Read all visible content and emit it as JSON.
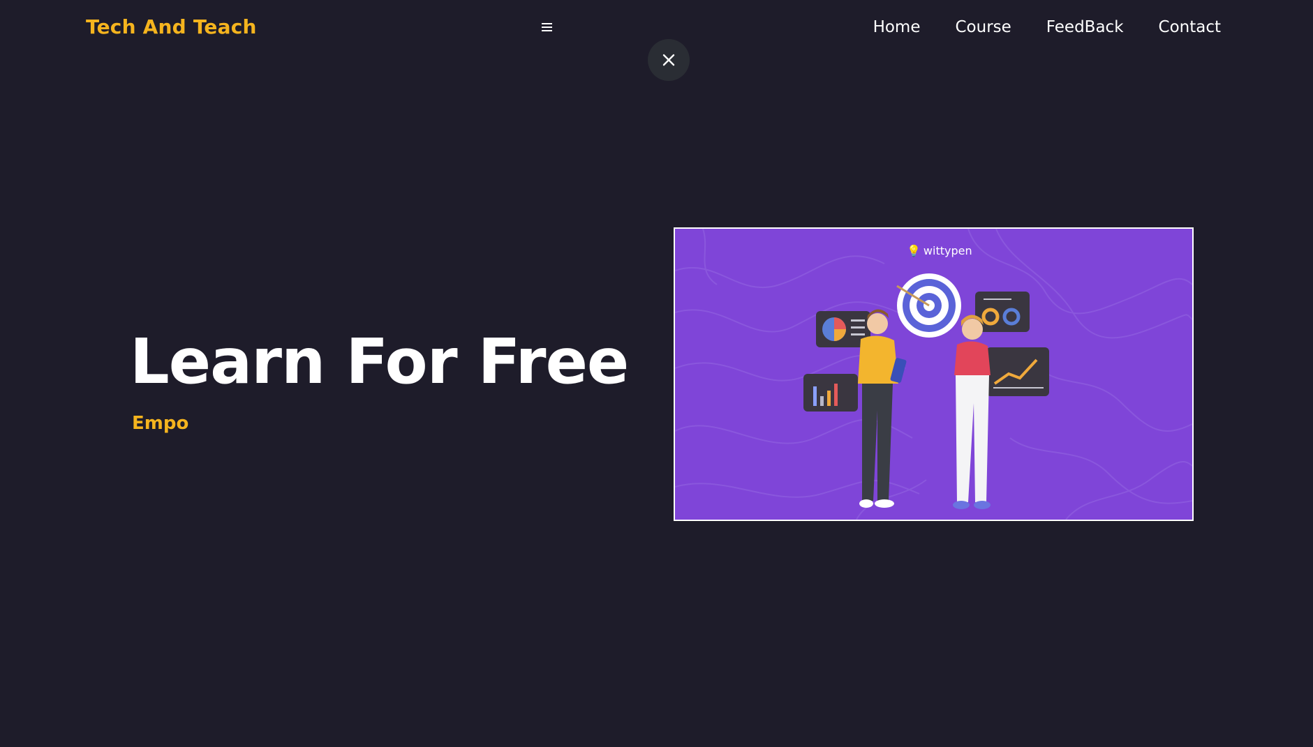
{
  "header": {
    "brand": "Tech And Teach",
    "menu_icon": "hamburger-menu-icon",
    "close_icon": "close-icon",
    "nav": [
      {
        "label": "Home"
      },
      {
        "label": "Course"
      },
      {
        "label": "FeedBack"
      },
      {
        "label": "Contact"
      }
    ]
  },
  "hero": {
    "title": "Learn For Free",
    "typed_text": "Empo",
    "image": {
      "brand_text": "wittypen",
      "description_icon": "illustration-image"
    }
  },
  "colors": {
    "background": "#1e1c2a",
    "accent": "#f5b41e",
    "image_bg": "#7f45d8",
    "close_bg": "#2a2d34"
  }
}
